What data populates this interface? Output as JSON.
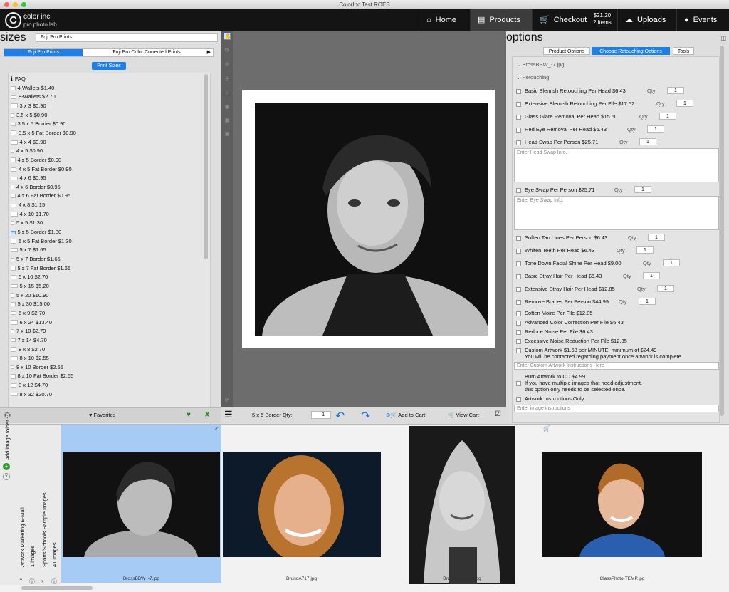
{
  "window": {
    "title": "ColorInc Test ROES"
  },
  "brand": {
    "name": "color inc",
    "tagline": "pro photo lab"
  },
  "nav": {
    "home": "Home",
    "products": "Products",
    "checkout": "Checkout",
    "cart_total": "$21.20",
    "cart_items": "2 items",
    "uploads": "Uploads",
    "events": "Events"
  },
  "left": {
    "title": "sizes",
    "product_select": "Fuji Pro Prints",
    "tab_1": "Fuji Pro Prints",
    "tab_2": "Fuji Pro Color Corrected Prints",
    "print_sizes_btn": "Print Sizes",
    "items": [
      "FAQ",
      "4-Wallets $1.40",
      "8-Wallets $2.70",
      "3 x 3  $0.90",
      "3.5 x 5  $0.90",
      "3.5 x 5 Border $0.90",
      "3.5 x 5 Fat Border $0.90",
      "4 x 4  $0.90",
      "4 x 5  $0.90",
      "4 x 5 Border $0.90",
      "4 x 5 Fat Border $0.90",
      "4 x 6 $0.95",
      "4 x 6 Border $0.95",
      "4 x 6 Fat Border $0.95",
      "4 x 8 $1.15",
      "4 x 10 $1.70",
      "5 x 5 $1.30",
      "5 x 5 Border $1.30",
      "5 x 5 Fat Border $1.30",
      "5 x 7 $1.65",
      "5 x 7 Border $1.65",
      "5 x 7 Fat Border $1.65",
      "5 x 10 $2.70",
      "5 x 15 $5.20",
      "5 x 20 $10.90",
      "5 x 30 $15.00",
      "6 x 9 $2.70",
      "6 x 24 $13.40",
      "7 x 10 $2.70",
      "7 x 14 $4.70",
      "8 x 8 $2.70",
      "8 x 10 $2.55",
      "8 x 10 Border $2.55",
      "8 x 10 Fat Border $2.55",
      "8 x 12 $4.70",
      "8 x 32 $20.70"
    ],
    "favorites": "Favorites"
  },
  "center": {
    "qty_label": "5 x 5 Border Qty:",
    "qty_value": "1",
    "add_to_cart": "Add to Cart",
    "view_cart": "View Cart"
  },
  "right": {
    "title": "options",
    "tab_product": "Product Options",
    "tab_retouch": "Choose Retouching Options",
    "tab_tools": "Tools",
    "file_name": "BrossBBW_-7.jpg",
    "section": "Retouching",
    "qty": "Qty",
    "qty_value": "1",
    "opt_blemish": "Basic Blemish Retouching Per Head $6.43",
    "opt_ext_blemish": "Extensive Blemish Retouching Per File $17.52",
    "opt_glare": "Glass Glare Removal Per Head $15.60",
    "opt_redeye": "Red Eye Removal Per Head $6.43",
    "opt_headswap": "Head Swap Per Person $25.71",
    "headswap_ph": "Enter Head Swap Info.",
    "opt_eyeswap": "Eye Swap Per Person $25.71",
    "eyeswap_ph": "Enter Eye Swap Info.",
    "opt_tan": "Soften Tan Lines Per Person $6.43",
    "opt_teeth": "Whiten Teeth Per Head $6.43",
    "opt_shine": "Tone Down Facial Shine Per Head $9.00",
    "opt_stray": "Basic Stray Hair Per Head $6.43",
    "opt_ext_stray": "Extensive Stray Hair Per Head $12.85",
    "opt_braces": "Remove Braces Per Person $44.99",
    "opt_moire": "Soften Moire Per File $12.85",
    "opt_adv_color": "Advanced Color Correction Per File $6.43",
    "opt_noise": "Reduce Noise Per File $6.43",
    "opt_exc_noise": "Excessive Noise Reduction Per File $12.85",
    "opt_custom_1": "Custom Artwork $1.63 per MINUTE, minimum of $24.49",
    "opt_custom_2": "You will be contacted regarding payment once artwork is complete.",
    "custom_ph": "Enter Custom Artwork Instructions Here",
    "burn_1": "Burn Artwork to CD $4.99",
    "burn_2": "If you have multiple images that need adjustment,",
    "burn_3": "this option only needs to be selected once.",
    "artwork_only": "Artwork Instructions Only",
    "image_instr_ph": "Enter image instructions"
  },
  "folders": {
    "add": "Add image folder",
    "folder1_name": "Artwork Marketing E-Mail",
    "folder1_count": "1 images",
    "folder2_name": "Sports/Schools Sample Images",
    "folder2_count": "41 images"
  },
  "thumbs": [
    "BrossBBW_-7.jpg",
    "BrunoA717.jpg",
    "BrunoABW707.jpg",
    "ClassPhoto-TEMP.jpg"
  ],
  "colors": {
    "accent": "#1e7fe6",
    "nav_bg": "#141414"
  }
}
